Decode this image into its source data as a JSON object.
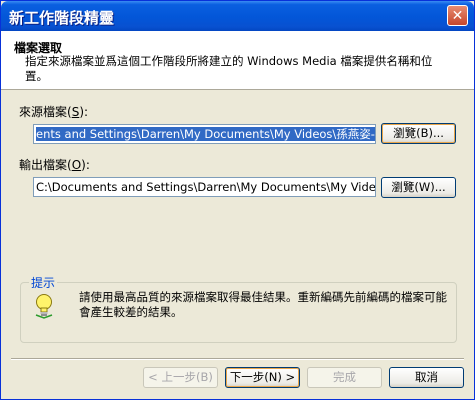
{
  "window": {
    "title": "新工作階段精靈",
    "close_label": "✕"
  },
  "header": {
    "title": "檔案選取",
    "description": "指定來源檔案並爲這個工作階段所將建立的 Windows Media 檔案提供名稱和位置。"
  },
  "source": {
    "label": "來源檔案(",
    "accel": "S",
    "label_end": "):",
    "value": "ents and Settings\\Darren\\My Documents\\My Videos\\孫燕姿-遇見.wmv",
    "browse_label": "瀏覽(B)..."
  },
  "output": {
    "label": "輸出檔案(",
    "accel": "O",
    "label_end": "):",
    "value": "C:\\Documents and Settings\\Darren\\My Documents\\My Videos\\孫燕姿-i",
    "browse_label": "瀏覽(W)..."
  },
  "tip": {
    "title": "提示",
    "text": "請使用最高品質的來源檔案取得最佳結果。重新編碼先前編碼的檔案可能會產生較差的結果。",
    "icon": "lightbulb-icon"
  },
  "footer": {
    "back_label": "< 上一步(B)",
    "next_label": "下一步(N) >",
    "finish_label": "完成",
    "cancel_label": "取消"
  }
}
